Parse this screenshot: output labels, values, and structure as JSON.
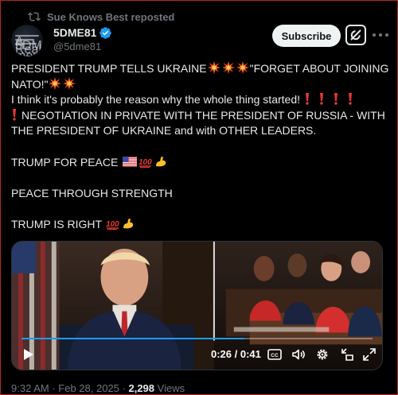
{
  "repost": {
    "label": "Sue Knows Best reposted",
    "icon": "repost-icon"
  },
  "author": {
    "name": "5DME81",
    "handle": "@5dme81",
    "verified": true,
    "avatar_lines": [
      "A member of the",
      "5DME81 team",
      "Real Truth Seekers"
    ]
  },
  "actions": {
    "subscribe_label": "Subscribe",
    "grok_icon": "grok-icon",
    "more_icon": "more-icon"
  },
  "tweet": {
    "line1_prefix": "PRESIDENT TRUMP TELLS UKRAINE",
    "line1_suffix": "\"FORGET ABOUT JOINING",
    "line2_prefix": "NATO!\"",
    "line3": "I think it's probably the reason why the whole thing started!",
    "line4": "NEGOTIATION IN PRIVATE WITH THE PRESIDENT OF RUSSIA - WITH",
    "line5": "THE PRESIDENT OF UKRAINE and with OTHER LEADERS.",
    "line6": "TRUMP FOR PEACE",
    "line7": "PEACE THROUGH STRENGTH",
    "line8": "TRUMP IS RIGHT"
  },
  "video": {
    "time": "0:26 / 0:41",
    "progress": 0.634,
    "icons": [
      "play-icon",
      "captions-icon",
      "volume-icon",
      "settings-icon",
      "minimize-icon",
      "fullscreen-icon"
    ],
    "captions_label": "CC"
  },
  "meta": {
    "time": "9:32 AM",
    "date": "Feb 28, 2025",
    "views_count": "2,298",
    "views_label": "Views"
  },
  "colors": {
    "accent": "#1d9bf0",
    "background": "#000000",
    "text": "#e7e9ea",
    "muted": "#71767b",
    "border": "#b3261e",
    "subscribe_bg": "#eff3f4"
  }
}
